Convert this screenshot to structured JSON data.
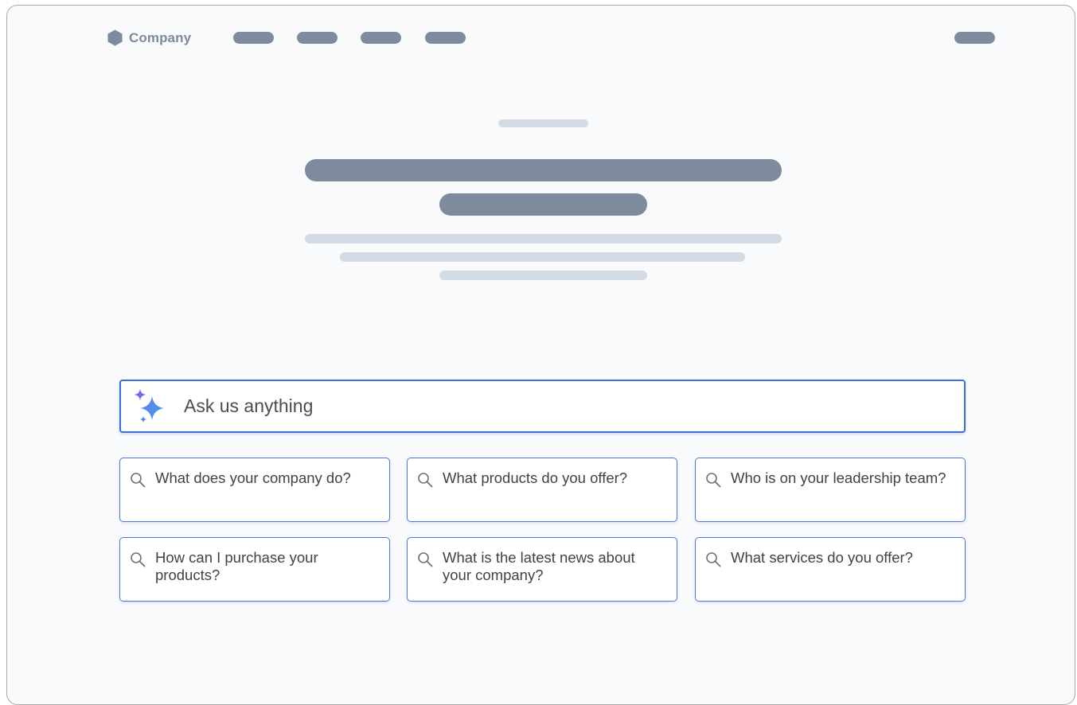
{
  "header": {
    "logo_text": "Company",
    "logo_icon": "hexagon-icon"
  },
  "search": {
    "placeholder": "Ask us anything",
    "icon": "sparkle-icon",
    "accent_color": "#3a6fd8"
  },
  "suggestions": [
    "What does your company do?",
    "What products do you offer?",
    "Who is on your leadership team?",
    "How can I purchase your products?",
    "What is the latest news about your company?",
    "What services do you offer?"
  ],
  "colors": {
    "placeholder_dark": "#7e8b9d",
    "placeholder_light": "#d3dce5",
    "card_border": "#4a79da",
    "background": "#f9fafc"
  }
}
